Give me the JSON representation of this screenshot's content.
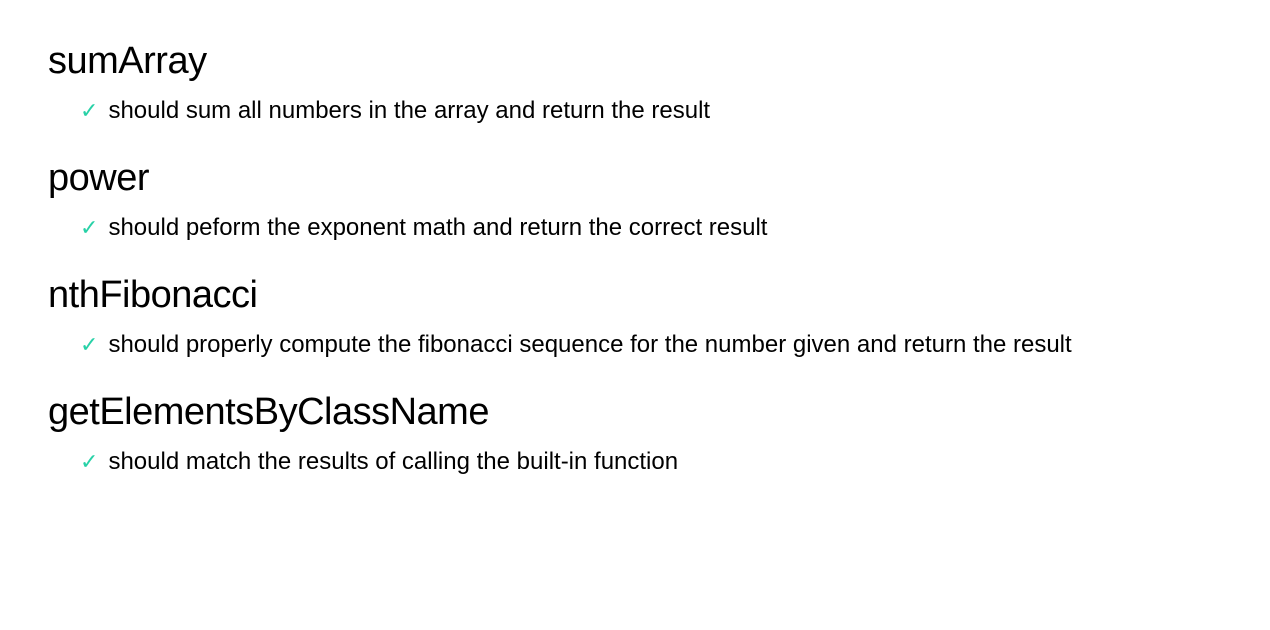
{
  "colors": {
    "pass": "#28d1a7",
    "text": "#000000",
    "background": "#ffffff"
  },
  "suites": [
    {
      "title": "sumArray",
      "tests": [
        {
          "status": "pass",
          "text": "should sum all numbers in the array and return the result"
        }
      ]
    },
    {
      "title": "power",
      "tests": [
        {
          "status": "pass",
          "text": "should peform the exponent math and return the correct result"
        }
      ]
    },
    {
      "title": "nthFibonacci",
      "tests": [
        {
          "status": "pass",
          "text": "should properly compute the fibonacci sequence for the number given and return the result"
        }
      ]
    },
    {
      "title": "getElementsByClassName",
      "tests": [
        {
          "status": "pass",
          "text": "should match the results of calling the built-in function"
        }
      ]
    }
  ]
}
